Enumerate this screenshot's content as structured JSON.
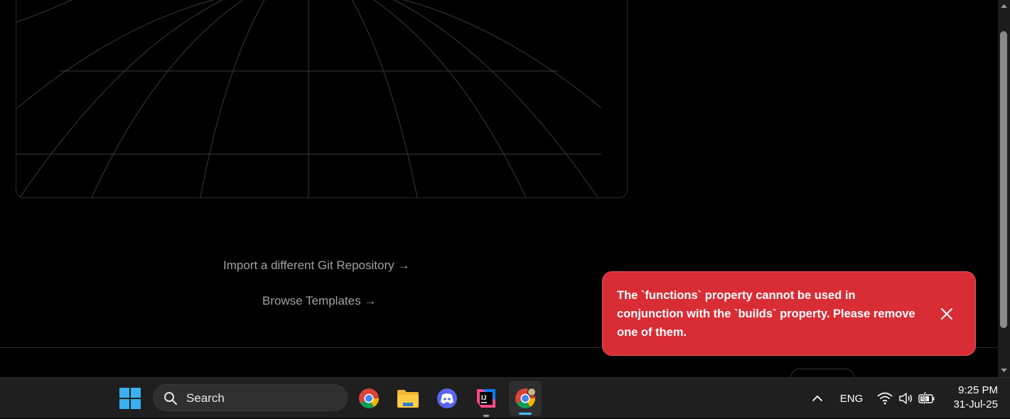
{
  "links": {
    "import_repo": "Import a different Git Repository →",
    "browse_templates": "Browse Templates →"
  },
  "toast": {
    "message": "The `functions` property cannot be used in conjunction with the `builds` property. Please remove one of them.",
    "close_icon": "close-icon",
    "color": "#d92d35"
  },
  "taskbar": {
    "search_placeholder": "Search",
    "apps": [
      {
        "name": "Google Chrome",
        "icon": "chrome-icon"
      },
      {
        "name": "File Explorer",
        "icon": "folder-icon"
      },
      {
        "name": "Discord",
        "icon": "discord-icon"
      },
      {
        "name": "IntelliJ IDEA",
        "icon": "intellij-icon"
      },
      {
        "name": "Google Chrome (profile)",
        "icon": "chrome-icon"
      }
    ],
    "tray": {
      "language": "ENG",
      "time": "9:25 PM",
      "date": "31-Jul-25"
    }
  },
  "colors": {
    "background": "#000000",
    "link": "#a1a1a1",
    "taskbar": "#1f1f1f",
    "accent": "#4cc2ff"
  }
}
